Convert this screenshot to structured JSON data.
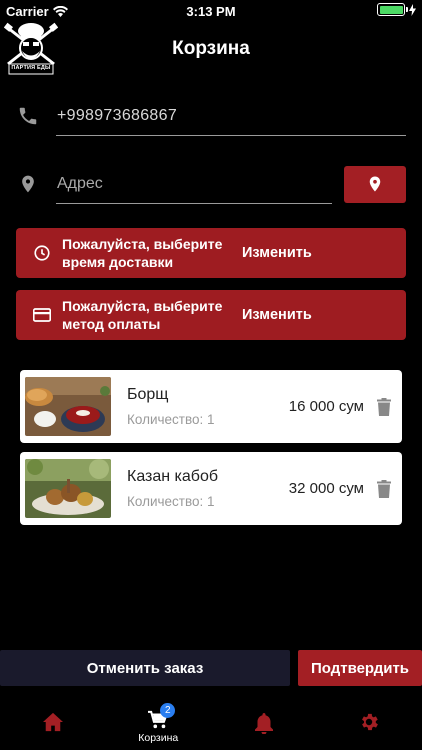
{
  "status_bar": {
    "carrier": "Carrier",
    "time": "3:13 PM"
  },
  "logo": {
    "text": "ПАРТИЯ ЕДЫ"
  },
  "header": {
    "title": "Корзина"
  },
  "phone": {
    "value": "+998973686867"
  },
  "address": {
    "placeholder": "Адрес"
  },
  "delivery_time": {
    "text": "Пожалуйста, выберите время доставки",
    "action": "Изменить"
  },
  "payment": {
    "text": "Пожалуйста, выберите метод оплаты",
    "action": "Изменить"
  },
  "cart": {
    "items": [
      {
        "name": "Борщ",
        "quantity": "Количество: 1",
        "price": "16 000 сум"
      },
      {
        "name": "Казан кабоб",
        "quantity": "Количество: 1",
        "price": "32 000 сум"
      }
    ]
  },
  "actions": {
    "cancel": "Отменить заказ",
    "confirm": "Подтвердить"
  },
  "tabbar": {
    "cart_label": "Корзина",
    "cart_badge": "2"
  },
  "colors": {
    "accent": "#a31f24",
    "cancel_bg": "#1a1a2c",
    "badge": "#2a7ef0"
  }
}
